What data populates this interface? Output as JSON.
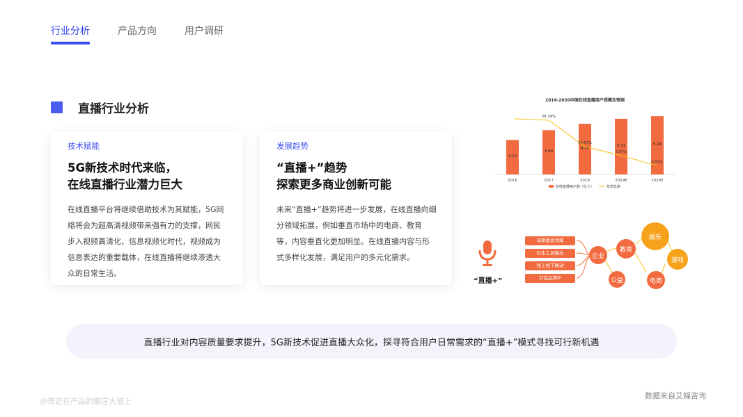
{
  "tabs": [
    {
      "label": "行业分析"
    },
    {
      "label": "产品方向"
    },
    {
      "label": "用户调研"
    }
  ],
  "section": {
    "title": "直播行业分析"
  },
  "cards": [
    {
      "tag": "技术赋能",
      "headline_line1": "5G新技术时代来临，",
      "headline_line2": "在线直播行业潜力巨大",
      "body": "在线直播平台将继续借助技术为其赋能，5G网络将会为超高清视频带来强有力的支撑，网民步入视频高清化、信息视频化时代，视频成为信息表达的重要载体，在线直播将继续渗透大众的日常生活。"
    },
    {
      "tag": "发展趋势",
      "headline_line1": "“直播+”趋势",
      "headline_line2": "探索更多商业创新可能",
      "body": "未来“直播+”趋势将进一步发展，在线直播向细分领域拓展，例如垂直市场中的电商、教育等，内容垂直化更加明显。在线直播内容与形式多样化发展，满足用户的多元化需求。"
    }
  ],
  "chart_data": {
    "type": "bar",
    "title": "2016-2020中国在线直播用户规模及预测",
    "categories": [
      "2016",
      "2017",
      "2018",
      "2019E",
      "2020E"
    ],
    "series": [
      {
        "name": "在线直播用户数（亿人）",
        "type": "bar",
        "values": [
          3.1,
          3.98,
          4.56,
          5.01,
          5.24
        ],
        "labels": [
          "3.10",
          "3.98",
          "4.56",
          "5.01",
          "5.24"
        ]
      },
      {
        "name": "年增长率",
        "type": "line",
        "values": [
          null,
          28.39,
          14.57,
          9.87,
          4.59
        ],
        "labels": [
          "",
          "28.39%",
          "14.57%",
          "9.87%",
          "4.59%"
        ]
      }
    ],
    "colors": {
      "bar": "#f26a3f",
      "line": "#f7c325"
    },
    "ylim": [
      0,
      5.5
    ],
    "line_ylim": [
      0,
      32
    ],
    "legend": "bottom",
    "grid": false
  },
  "flow": {
    "label": "“直播+”",
    "items": [
      "深耕垂直领域",
      "衍生工具输出",
      "线上线下联动",
      "打造品牌IP"
    ],
    "bubbles": [
      "企业",
      "教育",
      "娱乐",
      "游戏",
      "公益",
      "电商"
    ]
  },
  "summary": "直播行业对内容质量要求提升，5G新技术促进直播大众化，探寻符合用户日常需求的“直播+”模式寻找可行新机遇",
  "footer": {
    "left": "@奔走在产品的康庄大道上",
    "right": "数据来自艾媒咨询"
  },
  "colors": {
    "accent": "#3a4ff0",
    "orange": "#f26a3f",
    "yellow": "#f7c325"
  }
}
